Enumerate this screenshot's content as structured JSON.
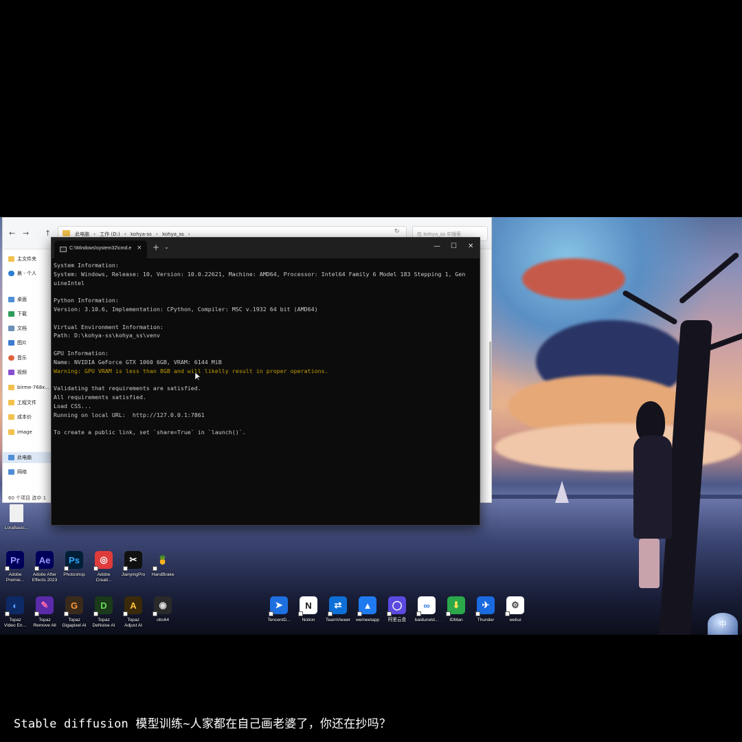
{
  "explorer": {
    "nav_back": "←",
    "nav_forward": "→",
    "nav_up": "↑",
    "breadcrumb": [
      "此电脑",
      "工作 (D:)",
      "kohya-ss",
      "kohya_ss"
    ],
    "breadcrumb_sep": "›",
    "refresh": "↻",
    "search_placeholder": "在 kohya_ss 中搜索",
    "sidebar": {
      "pinned": [
        {
          "label": "主文件夹",
          "icon": "home-icon",
          "color": "#f2c14e"
        },
        {
          "label": "晨 - 个人",
          "icon": "cloud-icon",
          "color": "#2d7fd3"
        }
      ],
      "quick": [
        {
          "label": "桌面",
          "icon": "desktop-icon",
          "color": "#4f8fd6"
        },
        {
          "label": "下载",
          "icon": "download-icon",
          "color": "#2d9d5a"
        },
        {
          "label": "文档",
          "icon": "document-icon",
          "color": "#6c8fb5"
        },
        {
          "label": "图片",
          "icon": "picture-icon",
          "color": "#3e7bd1"
        },
        {
          "label": "音乐",
          "icon": "music-icon",
          "color": "#e0623c"
        },
        {
          "label": "视频",
          "icon": "video-icon",
          "color": "#8a4fd0"
        },
        {
          "label": "birme-768x...",
          "icon": "folder-icon",
          "color": "#f2c14e"
        },
        {
          "label": "工程文件",
          "icon": "folder-icon",
          "color": "#f2c14e"
        },
        {
          "label": "成本价",
          "icon": "folder-icon",
          "color": "#f2c14e"
        },
        {
          "label": "image",
          "icon": "folder-icon",
          "color": "#f2c14e"
        }
      ],
      "devices": [
        {
          "label": "此电脑",
          "icon": "computer-icon",
          "color": "#4f8fd6"
        },
        {
          "label": "网络",
          "icon": "network-icon",
          "color": "#4f8fd6"
        }
      ]
    },
    "status": "60 个项目    选中 1"
  },
  "cmd": {
    "tab_title": "C:\\Windows\\system32\\cmd.e",
    "tab_close": "×",
    "new_tab": "+",
    "dropdown": "⌄",
    "minimize": "—",
    "maximize": "☐",
    "close": "✕",
    "lines": [
      {
        "text": "System Information:",
        "type": "normal"
      },
      {
        "text": "System: Windows, Release: 10, Version: 10.0.22621, Machine: AMD64, Processor: Intel64 Family 6 Model 183 Stepping 1, Gen",
        "type": "normal"
      },
      {
        "text": "uineIntel",
        "type": "normal"
      },
      {
        "text": "",
        "type": "normal"
      },
      {
        "text": "Python Information:",
        "type": "normal"
      },
      {
        "text": "Version: 3.10.6, Implementation: CPython, Compiler: MSC v.1932 64 bit (AMD64)",
        "type": "normal"
      },
      {
        "text": "",
        "type": "normal"
      },
      {
        "text": "Virtual Environment Information:",
        "type": "normal"
      },
      {
        "text": "Path: D:\\kohya-ss\\kohya_ss\\venv",
        "type": "normal"
      },
      {
        "text": "",
        "type": "normal"
      },
      {
        "text": "GPU Information:",
        "type": "normal"
      },
      {
        "text": "Name: NVIDIA GeForce GTX 1060 6GB, VRAM: 6144 MiB",
        "type": "normal"
      },
      {
        "text": "Warning: GPU VRAM is less than 8GB and will likelly result in proper operations.",
        "type": "warn"
      },
      {
        "text": "",
        "type": "normal"
      },
      {
        "text": "Validating that requirements are satisfied.",
        "type": "normal"
      },
      {
        "text": "All requirements satisfied.",
        "type": "normal"
      },
      {
        "text": "Load CSS...",
        "type": "normal"
      },
      {
        "text": "Running on local URL:  http://127.0.0.1:7861",
        "type": "normal"
      },
      {
        "text": "",
        "type": "normal"
      },
      {
        "text": "To create a public link, set `share=True` in `launch()`.",
        "type": "normal"
      }
    ]
  },
  "desktop": {
    "file_icon_label": "LoraBasic...",
    "row1": [
      {
        "label": "Adobe\nPremie...",
        "glyph": "Pr",
        "bg": "#00005b",
        "fg": "#9999ff",
        "icon": "premiere-icon"
      },
      {
        "label": "Adobe After\nEffects 2023",
        "glyph": "Ae",
        "bg": "#00005b",
        "fg": "#9999ff",
        "icon": "after-effects-icon"
      },
      {
        "label": "Photoshop",
        "glyph": "Ps",
        "bg": "#001e36",
        "fg": "#31a8ff",
        "icon": "photoshop-icon"
      },
      {
        "label": "Adobe\nCreati...",
        "glyph": "◎",
        "bg": "#e03b3b",
        "fg": "#ffffff",
        "icon": "creative-cloud-icon"
      },
      {
        "label": "JianyingPro",
        "glyph": "✂",
        "bg": "#111111",
        "fg": "#ffffff",
        "icon": "jianying-icon"
      },
      {
        "label": "HandBrake",
        "glyph": "🍍",
        "bg": "transparent",
        "fg": "#e3a72f",
        "icon": "handbrake-icon"
      }
    ],
    "row2": [
      {
        "label": "Topaz\nVideo En...",
        "glyph": "◐",
        "bg": "#0e2a66",
        "fg": "#5aa0ff",
        "icon": "topaz-video-icon"
      },
      {
        "label": "Topaz\nRemove All",
        "glyph": "✎",
        "bg": "#5a2aa8",
        "fg": "#ff6ab0",
        "icon": "topaz-remove-icon"
      },
      {
        "label": "Topaz\nGigapixel AI",
        "glyph": "G",
        "bg": "#3a2a1a",
        "fg": "#ff9a3a",
        "icon": "topaz-gigapixel-icon"
      },
      {
        "label": "Topaz\nDeNoise AI",
        "glyph": "D",
        "bg": "#1a3a1a",
        "fg": "#6ade5a",
        "icon": "topaz-denoise-icon"
      },
      {
        "label": "Topaz\nAdjust AI",
        "glyph": "A",
        "bg": "#3a2a0a",
        "fg": "#ffc23a",
        "icon": "topaz-adjust-icon"
      },
      {
        "label": "obs64",
        "glyph": "◉",
        "bg": "#2a2a2a",
        "fg": "#dddddd",
        "icon": "obs-icon"
      }
    ],
    "row3": [
      {
        "label": "TencentD...",
        "glyph": "➤",
        "bg": "#1e6fe0",
        "fg": "#ffffff",
        "icon": "tencent-download-icon"
      },
      {
        "label": "Notion",
        "glyph": "N",
        "bg": "#ffffff",
        "fg": "#111111",
        "icon": "notion-icon"
      },
      {
        "label": "TeamViewer",
        "glyph": "⇄",
        "bg": "#0e6fd6",
        "fg": "#ffffff",
        "icon": "teamviewer-icon"
      },
      {
        "label": "wemeetapp",
        "glyph": "▲",
        "bg": "#1f7af0",
        "fg": "#ffffff",
        "icon": "wemeet-icon"
      },
      {
        "label": "阿里云盘",
        "glyph": "◯",
        "bg": "#5a4ae0",
        "fg": "#ffffff",
        "icon": "aliyun-drive-icon"
      },
      {
        "label": "baidunetd...",
        "glyph": "∞",
        "bg": "#ffffff",
        "fg": "#2a7ae0",
        "icon": "baidu-netdisk-icon"
      },
      {
        "label": "IDMan",
        "glyph": "⬇",
        "bg": "#2aa84a",
        "fg": "#ffe25a",
        "icon": "idm-icon"
      },
      {
        "label": "Thunder",
        "glyph": "✈",
        "bg": "#1a6ae0",
        "fg": "#ffffff",
        "icon": "thunder-icon"
      },
      {
        "label": "webui",
        "glyph": "⚙",
        "bg": "#ffffff",
        "fg": "#444444",
        "icon": "webui-icon"
      }
    ],
    "ime": "中"
  },
  "caption": "Stable diffusion 模型训练~人家都在自己画老婆了，你还在抄吗？"
}
